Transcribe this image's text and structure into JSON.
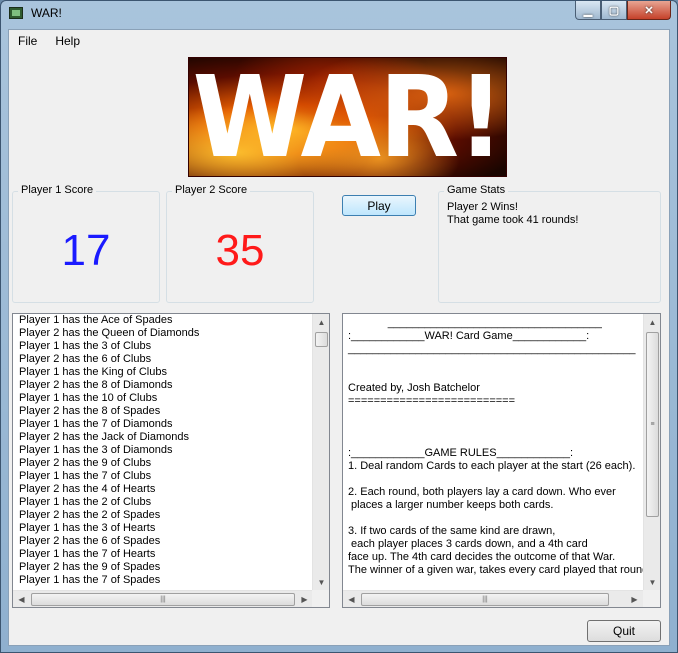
{
  "window": {
    "title": "WAR!",
    "minimize": "▁",
    "maximize": "▢",
    "close": "✕"
  },
  "menu": {
    "items": [
      "File",
      "Help"
    ]
  },
  "banner": {
    "text": "WAR!"
  },
  "player1": {
    "label": "Player 1 Score",
    "score": "17",
    "color": "#1a1aff"
  },
  "player2": {
    "label": "Player 2 Score",
    "score": "35",
    "color": "#ff1a1a"
  },
  "play_button": "Play",
  "stats": {
    "label": "Game Stats",
    "lines": [
      "Player 2 Wins!",
      "That game took 41 rounds!"
    ]
  },
  "log": [
    "Player 1 has the Ace of Spades",
    "Player 2 has the Queen of Diamonds",
    "Player 1 has the 3 of Clubs",
    "Player 2 has the 6 of Clubs",
    "Player 1 has the King of Clubs",
    "Player 2 has the 8 of Diamonds",
    "Player 1 has the 10 of Clubs",
    "Player 2 has the 8 of Spades",
    "Player 1 has the 7 of Diamonds",
    "Player 2 has the Jack of Diamonds",
    "Player 1 has the 3 of Diamonds",
    "Player 2 has the 9 of Clubs",
    "Player 1 has the 7 of Clubs",
    "Player 2 has the 4 of Hearts",
    "Player 1 has the 2 of Clubs",
    "Player 2 has the 2 of Spades",
    "Player 1 has the 3 of Hearts",
    "Player 2 has the 6 of Spades",
    "Player 1 has the 7 of Hearts",
    "Player 2 has the 9 of Spades",
    "Player 1 has the 7 of Spades"
  ],
  "rules_text": [
    "             ___________________________________",
    ":____________WAR! Card Game____________:",
    "_______________________________________________",
    "",
    "",
    "Created by, Josh Batchelor",
    "==========================",
    "",
    "",
    "",
    ":____________GAME RULES____________:",
    "1. Deal random Cards to each player at the start (26 each).",
    "",
    "2. Each round, both players lay a card down. Who ever",
    " places a larger number keeps both cards.",
    "",
    "3. If two cards of the same kind are drawn,",
    " each player places 3 cards down, and a 4th card",
    "face up. The 4th card decides the outcome of that War.",
    "The winner of a given war, takes every card played that round"
  ],
  "quit_button": "Quit"
}
